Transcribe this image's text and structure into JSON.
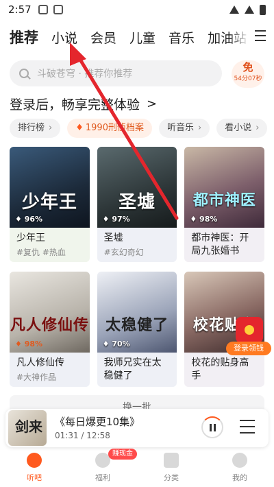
{
  "status_bar": {
    "time": "2:57"
  },
  "top_tabs": [
    "推荐",
    "小说",
    "会员",
    "儿童",
    "音乐",
    "加油站"
  ],
  "search": {
    "placeholder": "斗破苍穹 · 推荐你推荐"
  },
  "free_badge": {
    "label": "免",
    "countdown": "54分07秒"
  },
  "login_banner": {
    "text": "登录后，畅享完整体验",
    "chevron": ">"
  },
  "chips": [
    {
      "label": "排行榜"
    },
    {
      "label": "1990刑侦档案",
      "hot": true
    },
    {
      "label": "听音乐"
    },
    {
      "label": "看小说"
    }
  ],
  "books_row1": [
    {
      "title": "少年王",
      "tags": "#复仇 #热血",
      "rating": "96%",
      "cover_text": "少年王"
    },
    {
      "title": "圣墟",
      "tags": "#玄幻奇幻",
      "rating": "97%",
      "cover_text": "圣墟"
    },
    {
      "title": "都市神医：开局九张婚书",
      "tags": "",
      "rating": "98%",
      "cover_text": "都市神医"
    }
  ],
  "books_row2": [
    {
      "title": "凡人修仙传",
      "tags": "#大神作品",
      "rating": "98%",
      "cover_text": "凡人修仙传"
    },
    {
      "title": "我师兄实在太稳健了",
      "tags": "",
      "rating": "70%",
      "cover_text": "太稳健了"
    },
    {
      "title": "校花的贴身高手",
      "tags": "",
      "rating": "",
      "cover_text": "校花贴身"
    }
  ],
  "gift": {
    "label": "登录领钱"
  },
  "refresh": {
    "label": "换一批"
  },
  "player": {
    "title": "《每日爆更10集》",
    "time": "01:31 / 12:58",
    "thumb_text": "剑来"
  },
  "bottom_nav": [
    {
      "label": "听吧",
      "active": true
    },
    {
      "label": "福利",
      "badge": "赚现金"
    },
    {
      "label": "分类"
    },
    {
      "label": "我的"
    }
  ],
  "colors": {
    "accent": "#ff5a1f",
    "annotation_arrow": "#e4262d"
  }
}
